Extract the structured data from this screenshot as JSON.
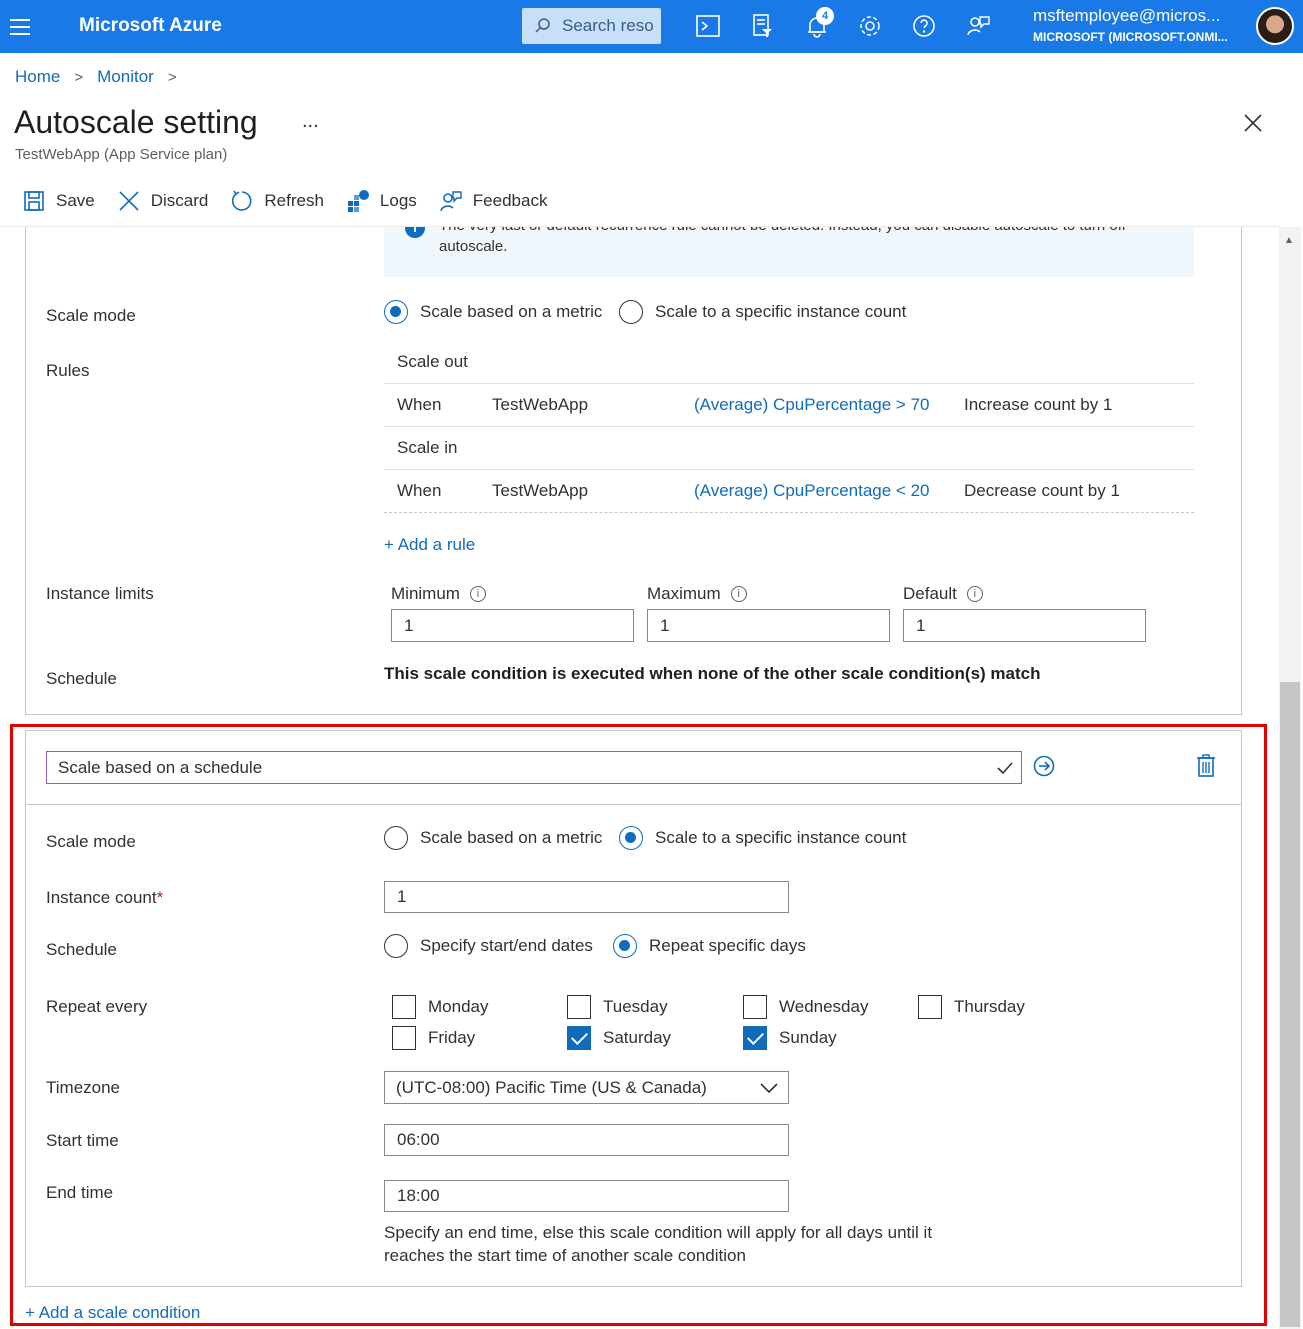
{
  "topbar": {
    "brand": "Microsoft Azure",
    "search_placeholder": "Search resources",
    "search_text": "Search reso",
    "notification_count": "4",
    "account_name": "msftemployee@micros...",
    "account_org": "MICROSOFT (MICROSOFT.ONMI..."
  },
  "breadcrumb": {
    "home": "Home",
    "monitor": "Monitor",
    "sep": ">"
  },
  "header": {
    "title": "Autoscale setting",
    "ellipsis": "...",
    "subtitle": "TestWebApp (App Service plan)"
  },
  "toolbar": {
    "save": "Save",
    "discard": "Discard",
    "refresh": "Refresh",
    "logs": "Logs",
    "feedback": "Feedback"
  },
  "default_condition": {
    "info_text": "The very last or default recurrence rule cannot be deleted. Instead, you can disable autoscale to turn off autoscale.",
    "scale_mode_label": "Scale mode",
    "scale_mode_options": [
      "Scale based on a metric",
      "Scale to a specific instance count"
    ],
    "scale_mode_selected": 0,
    "rules_label": "Rules",
    "rules": {
      "scale_out_header": "Scale out",
      "scale_in_header": "Scale in",
      "scale_out": {
        "when": "When",
        "resource": "TestWebApp",
        "metric": "(Average) CpuPercentage > 70",
        "action": "Increase count by 1"
      },
      "scale_in": {
        "when": "When",
        "resource": "TestWebApp",
        "metric": "(Average) CpuPercentage < 20",
        "action": "Decrease count by 1"
      }
    },
    "add_rule": "+ Add a rule",
    "instance_limits_label": "Instance limits",
    "minimum_label": "Minimum",
    "maximum_label": "Maximum",
    "default_label": "Default",
    "minimum": "1",
    "maximum": "1",
    "default": "1",
    "schedule_label": "Schedule",
    "schedule_note": "This scale condition is executed when none of the other scale condition(s) match"
  },
  "schedule_condition": {
    "name": "Scale based on a schedule",
    "scale_mode_label": "Scale mode",
    "scale_mode_options": [
      "Scale based on a metric",
      "Scale to a specific instance count"
    ],
    "scale_mode_selected": 1,
    "instance_count_label": "Instance count",
    "required_mark": "*",
    "instance_count": "1",
    "schedule_label": "Schedule",
    "schedule_options": [
      "Specify start/end dates",
      "Repeat specific days"
    ],
    "schedule_selected": 1,
    "repeat_every_label": "Repeat every",
    "days": [
      {
        "name": "Monday",
        "checked": false
      },
      {
        "name": "Tuesday",
        "checked": false
      },
      {
        "name": "Wednesday",
        "checked": false
      },
      {
        "name": "Thursday",
        "checked": false
      },
      {
        "name": "Friday",
        "checked": false
      },
      {
        "name": "Saturday",
        "checked": true
      },
      {
        "name": "Sunday",
        "checked": true
      }
    ],
    "timezone_label": "Timezone",
    "timezone": "(UTC-08:00) Pacific Time (US & Canada)",
    "start_time_label": "Start time",
    "start_time": "06:00",
    "end_time_label": "End time",
    "end_time": "18:00",
    "end_time_help": "Specify an end time, else this scale condition will apply for all days until it reaches the start time of another scale condition"
  },
  "add_scale_condition": "+ Add a scale condition",
  "colors": {
    "topbar": "#1979e6",
    "accent": "#0f6cbd",
    "highlight": "#e50000"
  }
}
